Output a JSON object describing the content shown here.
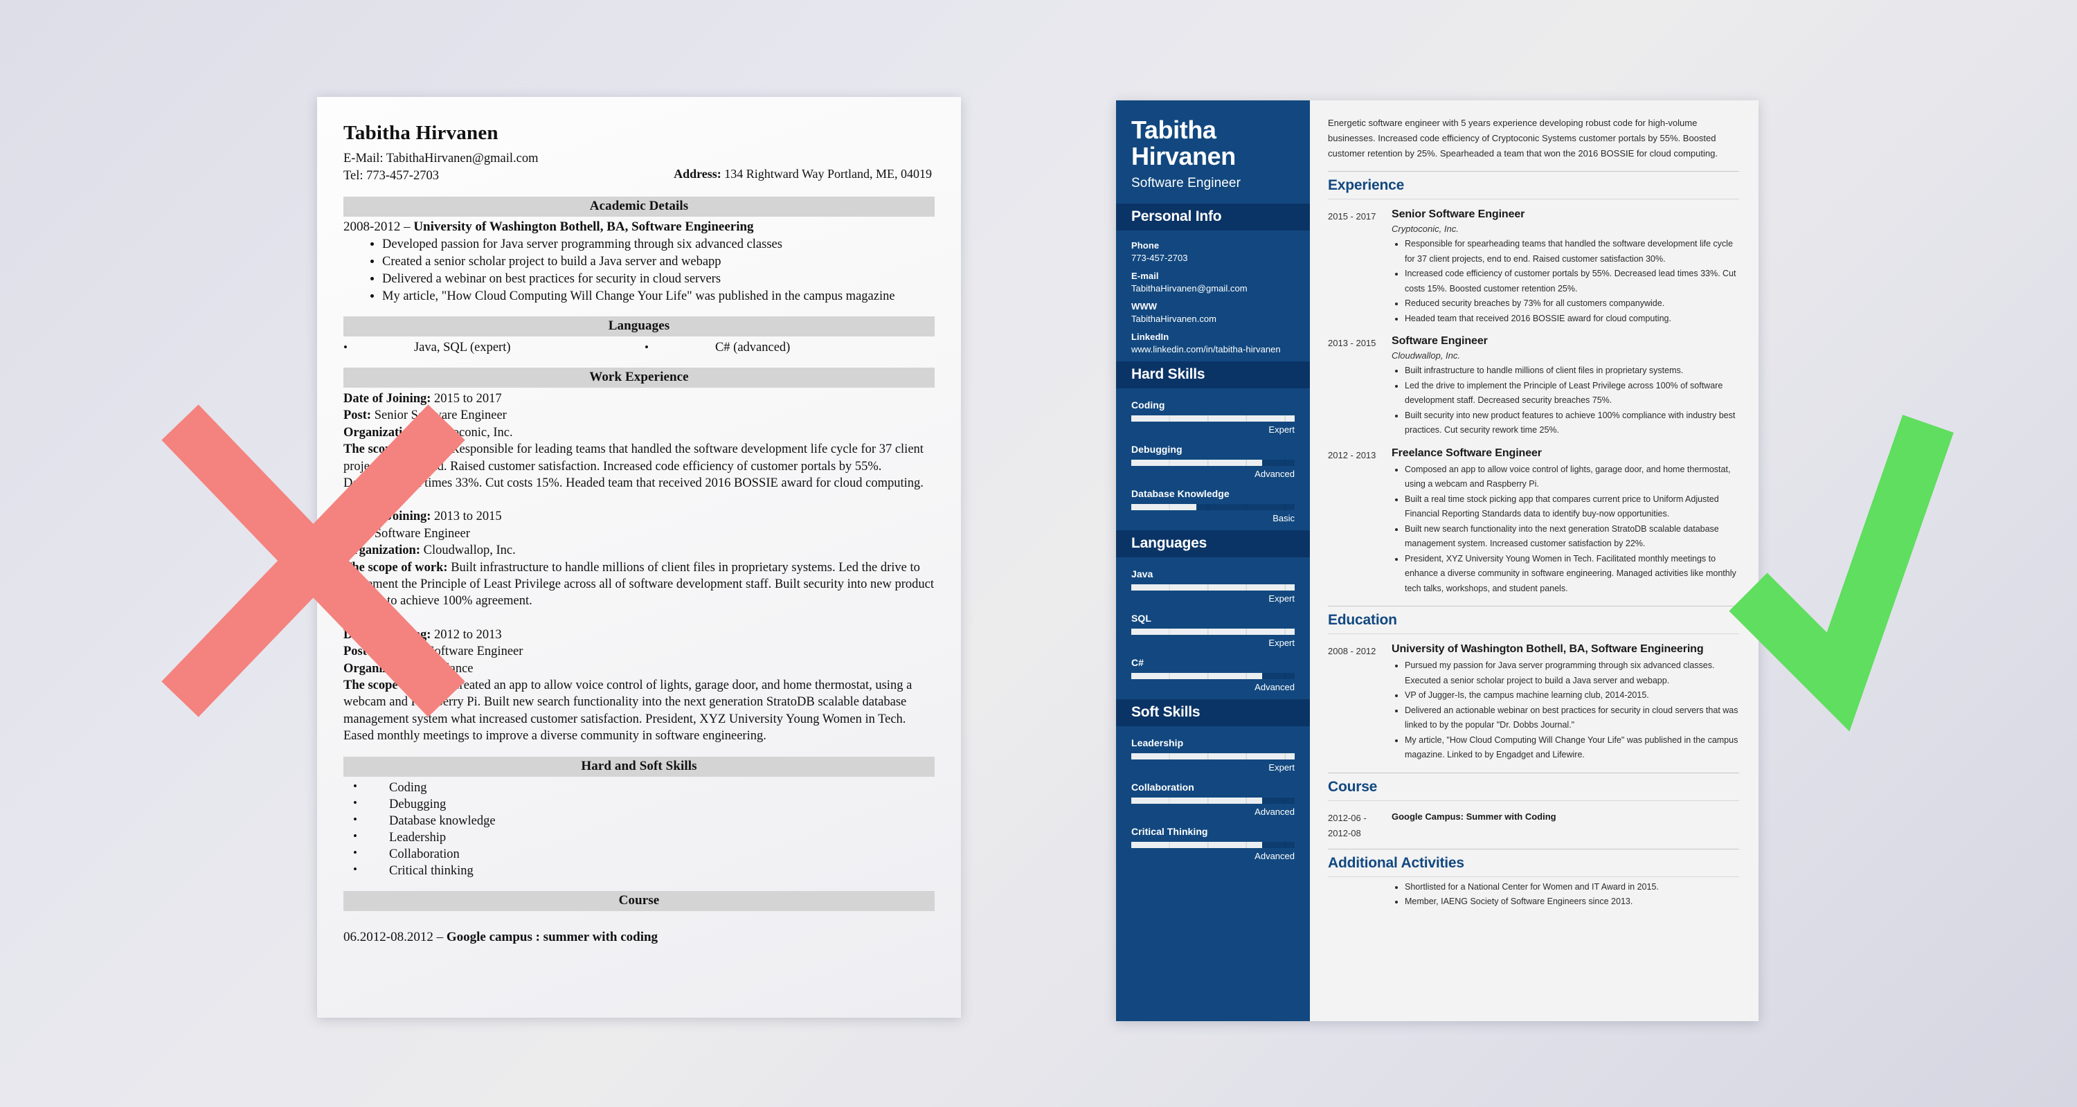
{
  "colors": {
    "background_gradient_start": "#dedee8",
    "background_gradient_end": "#d6d6e2",
    "reject_mark": "#f4827e",
    "accept_mark": "#5fde5f",
    "sidebar_blue": "#12487f",
    "sidebar_band_blue": "#0b3466",
    "heading_blue": "#12487f",
    "band_gray": "#d4d4d4"
  },
  "marks": {
    "reject": {
      "icon": "cross-mark",
      "color": "#f4827e"
    },
    "accept": {
      "icon": "check-mark",
      "color": "#5fde5f"
    }
  },
  "bad_resume": {
    "name": "Tabitha Hirvanen",
    "email_line": "E-Mail: TabithaHirvanen@gmail.com",
    "tel_line": "Tel: 773-457-2703",
    "address_label": "Address:",
    "address_value": "134 Rightward Way Portland, ME, 04019",
    "sections": {
      "academic": {
        "band": "Academic Details",
        "degree_years": "2008-2012",
        "degree_dash": "–",
        "degree": "University of Washington Bothell, BA, Software Engineering",
        "bullets": [
          "Developed passion for Java server programming through six advanced classes",
          "Created a senior scholar project to build a Java server and webapp",
          "Delivered a webinar on best practices for security in cloud servers",
          "My article, \"How Cloud Computing Will Change Your Life\" was published in the campus magazine"
        ]
      },
      "languages": {
        "band": "Languages",
        "items": [
          "Java, SQL (expert)",
          "C# (advanced)"
        ]
      },
      "work": {
        "band": "Work Experience",
        "label_date": "Date of Joining:",
        "label_post": "Post:",
        "label_org": "Organization:",
        "label_scope": "The scope of work:",
        "jobs": [
          {
            "date": "2015 to 2017",
            "post": "Senior Software Engineer",
            "org": "Cryptoconic, Inc.",
            "scope": "Responsible for leading teams that handled the software development life cycle for 37 client projects, end to end. Raised customer satisfaction. Increased code efficiency of customer portals by 55%. Decreased lead times 33%. Cut costs 15%. Headed team that received 2016 BOSSIE award for cloud computing."
          },
          {
            "date": "2013 to 2015",
            "post": "Software Engineer",
            "org": "Cloudwallop, Inc.",
            "scope": "Built infrastructure to handle millions of client files in proprietary systems. Led the drive to implement the Principle of Least Privilege across all of software development staff. Built security into new product features to achieve 100% agreement."
          },
          {
            "date": "2012 to 2013",
            "post": "Freelance Software Engineer",
            "org": "Freelance",
            "scope": "Created an app to allow voice control of lights, garage door, and home thermostat, using a webcam and Raspberry Pi. Built new search functionality into the next generation StratoDB scalable database management system what increased customer satisfaction. President, XYZ University Young Women in Tech. Eased monthly meetings to improve a diverse community in software engineering."
          }
        ]
      },
      "skills": {
        "band": "Hard and Soft Skills",
        "items": [
          "Coding",
          "Debugging",
          "Database knowledge",
          "Leadership",
          "Collaboration",
          "Critical thinking"
        ]
      },
      "course": {
        "band": "Course",
        "dates": "06.2012-08.2012",
        "dash": "–",
        "title": "Google campus : summer with coding"
      }
    }
  },
  "good_resume": {
    "sidebar": {
      "name": "Tabitha Hirvanen",
      "job_title": "Software Engineer",
      "personal_info": {
        "band": "Personal Info",
        "fields": [
          {
            "label": "Phone",
            "value": "773-457-2703"
          },
          {
            "label": "E-mail",
            "value": "TabithaHirvanen@gmail.com"
          },
          {
            "label": "WWW",
            "value": "TabithaHirvanen.com"
          },
          {
            "label": "LinkedIn",
            "value": "www.linkedin.com/in/tabitha-hirvanen"
          }
        ]
      },
      "hard_skills": {
        "band": "Hard Skills",
        "items": [
          {
            "name": "Coding",
            "level": "Expert",
            "percent": 100
          },
          {
            "name": "Debugging",
            "level": "Advanced",
            "percent": 80
          },
          {
            "name": "Database Knowledge",
            "level": "Basic",
            "percent": 40
          }
        ]
      },
      "languages": {
        "band": "Languages",
        "items": [
          {
            "name": "Java",
            "level": "Expert",
            "percent": 100
          },
          {
            "name": "SQL",
            "level": "Expert",
            "percent": 100
          },
          {
            "name": "C#",
            "level": "Advanced",
            "percent": 80
          }
        ]
      },
      "soft_skills": {
        "band": "Soft Skills",
        "items": [
          {
            "name": "Leadership",
            "level": "Expert",
            "percent": 100
          },
          {
            "name": "Collaboration",
            "level": "Advanced",
            "percent": 80
          },
          {
            "name": "Critical Thinking",
            "level": "Advanced",
            "percent": 80
          }
        ]
      }
    },
    "main": {
      "summary": "Energetic software engineer with 5 years experience developing robust code for high-volume businesses. Increased code efficiency of Cryptoconic Systems customer portals by 55%. Boosted customer retention by 25%. Spearheaded a team that won the 2016 BOSSIE for cloud computing.",
      "experience": {
        "heading": "Experience",
        "entries": [
          {
            "dates": "2015 - 2017",
            "role": "Senior Software Engineer",
            "org": "Cryptoconic, Inc.",
            "bullets": [
              "Responsible for spearheading teams that handled the software development life cycle for 37 client projects, end to end. Raised customer satisfaction 30%.",
              "Increased code efficiency of customer portals by 55%. Decreased lead times 33%. Cut costs 15%. Boosted customer retention 25%.",
              "Reduced security breaches by 73% for all customers companywide.",
              "Headed team that received 2016 BOSSIE award for cloud computing."
            ]
          },
          {
            "dates": "2013 - 2015",
            "role": "Software Engineer",
            "org": "Cloudwallop, Inc.",
            "bullets": [
              "Built infrastructure to handle millions of client files in proprietary systems.",
              "Led the drive to implement the Principle of Least Privilege across 100% of software development staff. Decreased security breaches 75%.",
              "Built security into new product features to achieve 100% compliance with industry best practices. Cut security rework time 25%."
            ]
          },
          {
            "dates": "2012 - 2013",
            "role": "Freelance Software Engineer",
            "org": "",
            "bullets": [
              "Composed an app to allow voice control of lights, garage door, and home thermostat, using a webcam and Raspberry Pi.",
              "Built a real time stock picking app that compares current price to Uniform Adjusted Financial Reporting Standards data to identify buy-now opportunities.",
              "Built new search functionality into the next generation StratoDB scalable database management system. Increased customer satisfaction by 22%.",
              "President, XYZ University Young Women in Tech. Facilitated monthly meetings to enhance a diverse community in software engineering. Managed activities like monthly tech talks, workshops, and student panels."
            ]
          }
        ]
      },
      "education": {
        "heading": "Education",
        "entries": [
          {
            "dates": "2008 - 2012",
            "role": "University of Washington Bothell, BA, Software Engineering",
            "bullets": [
              "Pursued my passion for Java server programming through six advanced classes. Executed a senior scholar project to build a Java server and webapp.",
              "VP of Jugger-Is, the campus machine learning club, 2014-2015.",
              "Delivered an actionable webinar on best practices for security in cloud servers that was linked to by the popular \"Dr. Dobbs Journal.\"",
              "My article, \"How Cloud Computing Will Change Your Life\" was published in the campus magazine. Linked to by Engadget and Lifewire."
            ]
          }
        ]
      },
      "course": {
        "heading": "Course",
        "dates": "2012-06 - 2012-08",
        "title": "Google Campus: Summer with Coding"
      },
      "additional_activities": {
        "heading": "Additional Activities",
        "bullets": [
          "Shortlisted for a National Center for Women and IT Award in 2015.",
          "Member, IAENG Society of Software Engineers since 2013."
        ]
      }
    }
  }
}
